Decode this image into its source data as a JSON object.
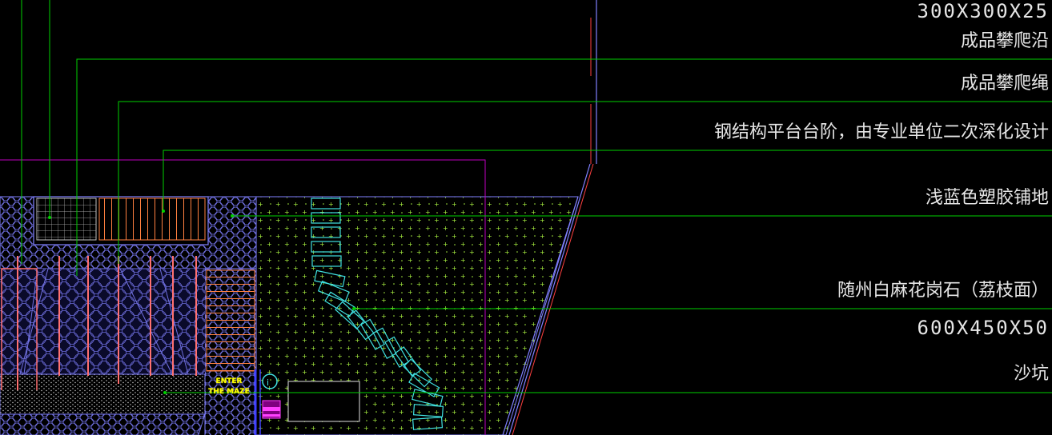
{
  "annotations": [
    {
      "id": "dim-300",
      "text": "300X300X25"
    },
    {
      "id": "climb-edge",
      "text": "成品攀爬沿"
    },
    {
      "id": "climb-rope",
      "text": "成品攀爬绳"
    },
    {
      "id": "steel-platform",
      "text": "钢结构平台台阶，由专业单位二次深化设计"
    },
    {
      "id": "rubber-paving",
      "text": "浅蓝色塑胶铺地"
    },
    {
      "id": "granite",
      "text": "随州白麻花岗石（荔枝面）"
    },
    {
      "id": "dim-600",
      "text": "600X450X50"
    },
    {
      "id": "sandpit",
      "text": "沙坑"
    }
  ],
  "maze_sign": {
    "line1": "ENTER",
    "line2": "THE MAZE"
  },
  "colors": {
    "background": "#000000",
    "leader": "#00e000",
    "text": "#e6e6e6",
    "paving_outline": "#8080ff",
    "stepping_stone": "#40e0e0",
    "magenta": "#c000c0",
    "timber": "#ff8040",
    "sand_dots": "#c0ff40"
  }
}
